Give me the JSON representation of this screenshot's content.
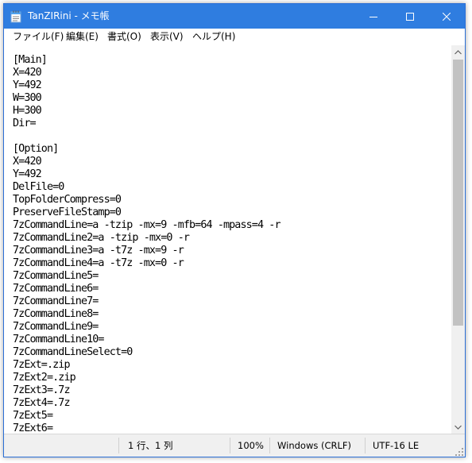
{
  "window": {
    "title": "TanZIRini - メモ帳"
  },
  "titlebar_buttons": {
    "minimize_icon": "minimize-icon",
    "maximize_icon": "maximize-icon",
    "close_icon": "close-icon"
  },
  "menu": {
    "items": [
      "ファイル(F)",
      "編集(E)",
      "書式(O)",
      "表示(V)",
      "ヘルプ(H)"
    ]
  },
  "editor": {
    "lines": [
      "[Main]",
      "X=420",
      "Y=492",
      "W=300",
      "H=300",
      "Dir=",
      "",
      "[Option]",
      "X=420",
      "Y=492",
      "DelFile=0",
      "TopFolderCompress=0",
      "PreserveFileStamp=0",
      "7zCommandLine=a -tzip -mx=9 -mfb=64 -mpass=4 -r",
      "7zCommandLine2=a -tzip -mx=0 -r",
      "7zCommandLine3=a -t7z -mx=9 -r",
      "7zCommandLine4=a -t7z -mx=0 -r",
      "7zCommandLine5=",
      "7zCommandLine6=",
      "7zCommandLine7=",
      "7zCommandLine8=",
      "7zCommandLine9=",
      "7zCommandLine10=",
      "7zCommandLineSelect=0",
      "7zExt=.zip",
      "7zExt2=.zip",
      "7zExt3=.7z",
      "7zExt4=.7z",
      "7zExt5=",
      "7zExt6="
    ]
  },
  "statusbar": {
    "position": "1 行、1 列",
    "zoom": "100%",
    "line_ending": "Windows (CRLF)",
    "encoding": "UTF-16 LE"
  },
  "colors": {
    "titlebar": "#2f7de0",
    "scroll_thumb": "#c2c2c2"
  }
}
